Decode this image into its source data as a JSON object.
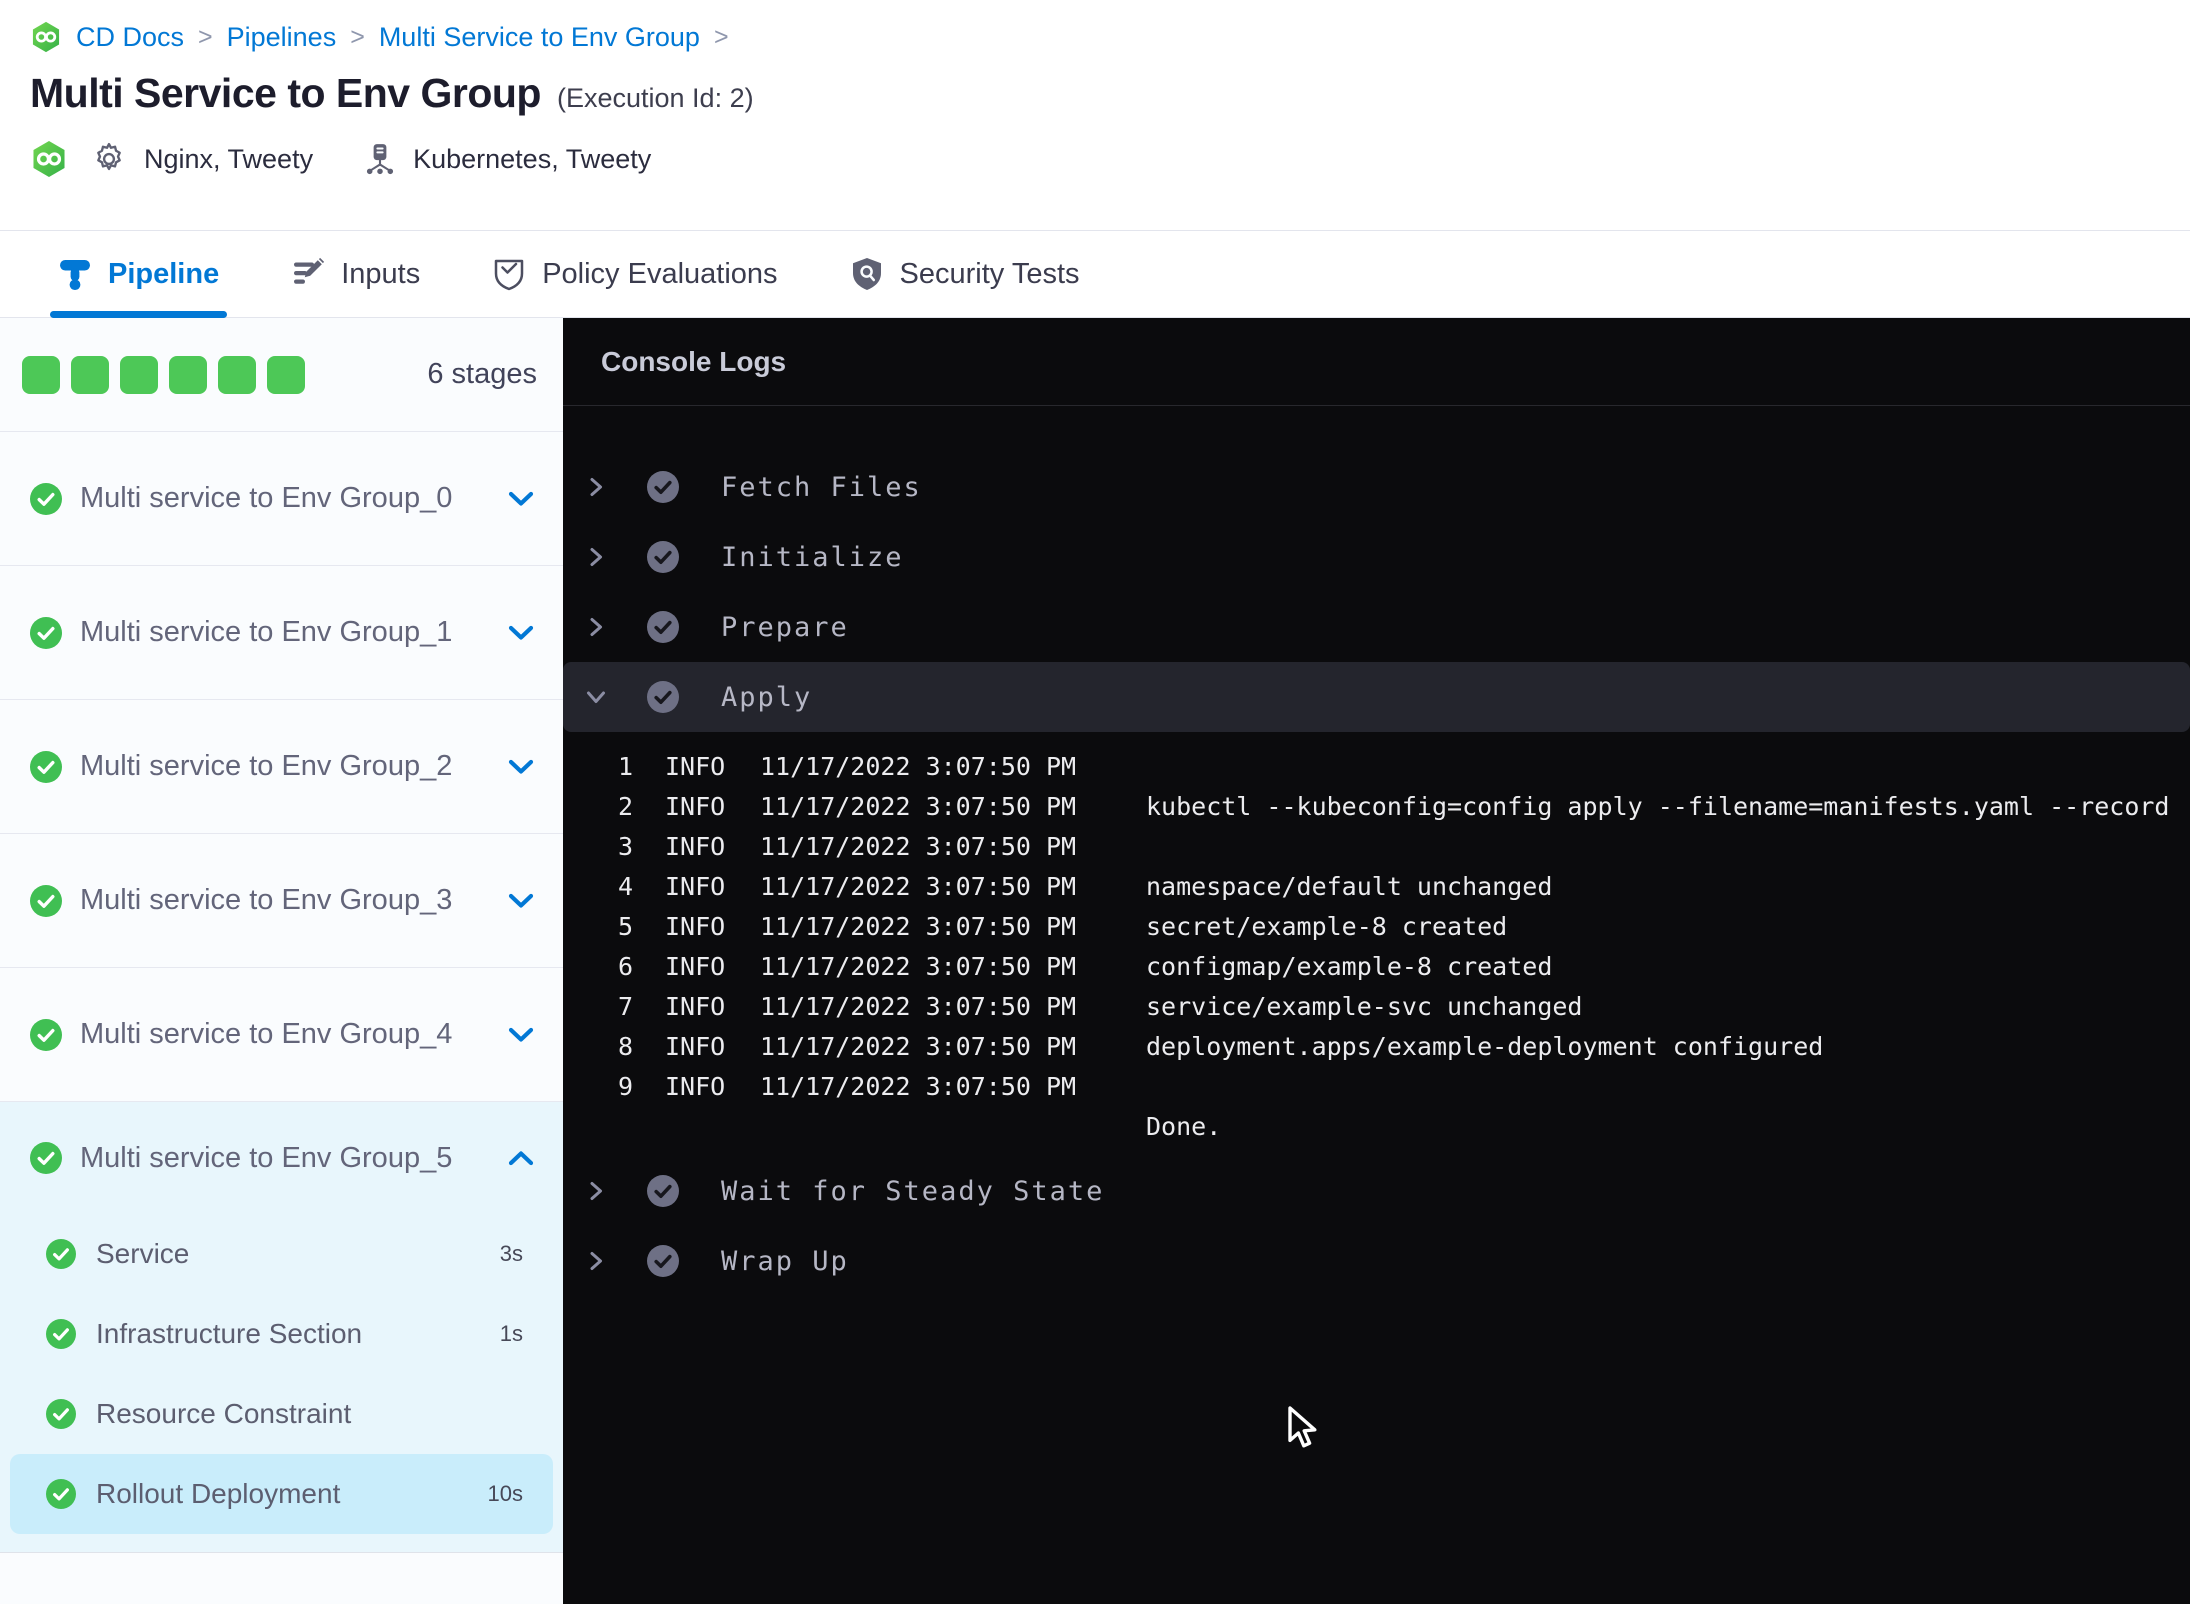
{
  "colors": {
    "accent_blue": "#0278d5",
    "success_green": "#40bf53",
    "progress_green": "#4dc857",
    "console_bg": "#0b0b0d",
    "expanded_stage_bg": "#e8f6fc",
    "selected_step_bg": "#c9edfb"
  },
  "breadcrumb": {
    "items": [
      "CD Docs",
      "Pipelines",
      "Multi Service to Env Group"
    ],
    "separator": ">"
  },
  "header": {
    "title": "Multi Service to Env Group",
    "execution_id": "(Execution Id: 2)",
    "services_label": "Nginx, Tweety",
    "environments_label": "Kubernetes, Tweety"
  },
  "tabs": [
    {
      "label": "Pipeline",
      "icon": "pipeline-icon",
      "active": true
    },
    {
      "label": "Inputs",
      "icon": "inputs-icon",
      "active": false
    },
    {
      "label": "Policy Evaluations",
      "icon": "policy-shield-icon",
      "active": false
    },
    {
      "label": "Security Tests",
      "icon": "security-shield-icon",
      "active": false
    }
  ],
  "sidebar": {
    "progress_square_count": 6,
    "stage_count_label": "6 stages",
    "stages": [
      {
        "label": "Multi service to Env Group_0",
        "status": "success",
        "expanded": false
      },
      {
        "label": "Multi service to Env Group_1",
        "status": "success",
        "expanded": false
      },
      {
        "label": "Multi service to Env Group_2",
        "status": "success",
        "expanded": false
      },
      {
        "label": "Multi service to Env Group_3",
        "status": "success",
        "expanded": false
      },
      {
        "label": "Multi service to Env Group_4",
        "status": "success",
        "expanded": false
      },
      {
        "label": "Multi service to Env Group_5",
        "status": "success",
        "expanded": true,
        "steps": [
          {
            "label": "Service",
            "duration": "3s",
            "status": "success",
            "selected": false
          },
          {
            "label": "Infrastructure Section",
            "duration": "1s",
            "status": "success",
            "selected": false
          },
          {
            "label": "Resource Constraint",
            "duration": "",
            "status": "success",
            "selected": false
          },
          {
            "label": "Rollout Deployment",
            "duration": "10s",
            "status": "success",
            "selected": true
          }
        ]
      }
    ]
  },
  "console": {
    "title": "Console Logs",
    "steps": [
      {
        "label": "Fetch Files",
        "status": "success",
        "expanded": false
      },
      {
        "label": "Initialize",
        "status": "success",
        "expanded": false
      },
      {
        "label": "Prepare",
        "status": "success",
        "expanded": false
      },
      {
        "label": "Apply",
        "status": "success",
        "expanded": true,
        "logs": [
          {
            "num": "1",
            "level": "INFO",
            "time": "11/17/2022 3:07:50 PM",
            "msg": ""
          },
          {
            "num": "2",
            "level": "INFO",
            "time": "11/17/2022 3:07:50 PM",
            "msg": "kubectl --kubeconfig=config apply --filename=manifests.yaml --record"
          },
          {
            "num": "3",
            "level": "INFO",
            "time": "11/17/2022 3:07:50 PM",
            "msg": ""
          },
          {
            "num": "4",
            "level": "INFO",
            "time": "11/17/2022 3:07:50 PM",
            "msg": "namespace/default unchanged"
          },
          {
            "num": "5",
            "level": "INFO",
            "time": "11/17/2022 3:07:50 PM",
            "msg": "secret/example-8 created"
          },
          {
            "num": "6",
            "level": "INFO",
            "time": "11/17/2022 3:07:50 PM",
            "msg": "configmap/example-8 created"
          },
          {
            "num": "7",
            "level": "INFO",
            "time": "11/17/2022 3:07:50 PM",
            "msg": "service/example-svc unchanged"
          },
          {
            "num": "8",
            "level": "INFO",
            "time": "11/17/2022 3:07:50 PM",
            "msg": "deployment.apps/example-deployment configured"
          },
          {
            "num": "9",
            "level": "INFO",
            "time": "11/17/2022 3:07:50 PM",
            "msg": ""
          },
          {
            "num": "",
            "level": "",
            "time": "",
            "msg": "Done."
          }
        ]
      },
      {
        "label": "Wait for Steady State",
        "status": "success",
        "expanded": false
      },
      {
        "label": "Wrap Up",
        "status": "success",
        "expanded": false
      }
    ]
  }
}
